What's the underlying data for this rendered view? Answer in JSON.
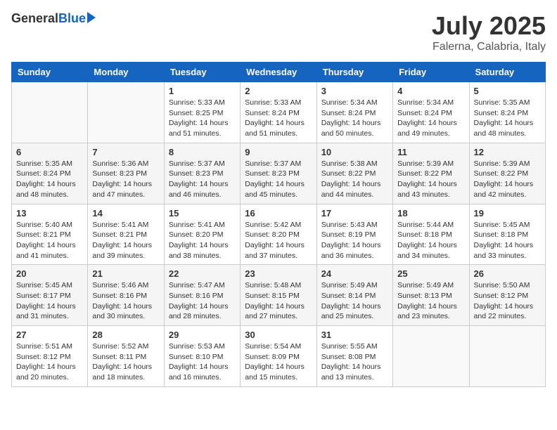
{
  "logo": {
    "general": "General",
    "blue": "Blue"
  },
  "title": "July 2025",
  "location": "Falerna, Calabria, Italy",
  "days_of_week": [
    "Sunday",
    "Monday",
    "Tuesday",
    "Wednesday",
    "Thursday",
    "Friday",
    "Saturday"
  ],
  "weeks": [
    [
      {
        "day": "",
        "info": ""
      },
      {
        "day": "",
        "info": ""
      },
      {
        "day": "1",
        "sunrise": "Sunrise: 5:33 AM",
        "sunset": "Sunset: 8:25 PM",
        "daylight": "Daylight: 14 hours and 51 minutes."
      },
      {
        "day": "2",
        "sunrise": "Sunrise: 5:33 AM",
        "sunset": "Sunset: 8:24 PM",
        "daylight": "Daylight: 14 hours and 51 minutes."
      },
      {
        "day": "3",
        "sunrise": "Sunrise: 5:34 AM",
        "sunset": "Sunset: 8:24 PM",
        "daylight": "Daylight: 14 hours and 50 minutes."
      },
      {
        "day": "4",
        "sunrise": "Sunrise: 5:34 AM",
        "sunset": "Sunset: 8:24 PM",
        "daylight": "Daylight: 14 hours and 49 minutes."
      },
      {
        "day": "5",
        "sunrise": "Sunrise: 5:35 AM",
        "sunset": "Sunset: 8:24 PM",
        "daylight": "Daylight: 14 hours and 48 minutes."
      }
    ],
    [
      {
        "day": "6",
        "sunrise": "Sunrise: 5:35 AM",
        "sunset": "Sunset: 8:24 PM",
        "daylight": "Daylight: 14 hours and 48 minutes."
      },
      {
        "day": "7",
        "sunrise": "Sunrise: 5:36 AM",
        "sunset": "Sunset: 8:23 PM",
        "daylight": "Daylight: 14 hours and 47 minutes."
      },
      {
        "day": "8",
        "sunrise": "Sunrise: 5:37 AM",
        "sunset": "Sunset: 8:23 PM",
        "daylight": "Daylight: 14 hours and 46 minutes."
      },
      {
        "day": "9",
        "sunrise": "Sunrise: 5:37 AM",
        "sunset": "Sunset: 8:23 PM",
        "daylight": "Daylight: 14 hours and 45 minutes."
      },
      {
        "day": "10",
        "sunrise": "Sunrise: 5:38 AM",
        "sunset": "Sunset: 8:22 PM",
        "daylight": "Daylight: 14 hours and 44 minutes."
      },
      {
        "day": "11",
        "sunrise": "Sunrise: 5:39 AM",
        "sunset": "Sunset: 8:22 PM",
        "daylight": "Daylight: 14 hours and 43 minutes."
      },
      {
        "day": "12",
        "sunrise": "Sunrise: 5:39 AM",
        "sunset": "Sunset: 8:22 PM",
        "daylight": "Daylight: 14 hours and 42 minutes."
      }
    ],
    [
      {
        "day": "13",
        "sunrise": "Sunrise: 5:40 AM",
        "sunset": "Sunset: 8:21 PM",
        "daylight": "Daylight: 14 hours and 41 minutes."
      },
      {
        "day": "14",
        "sunrise": "Sunrise: 5:41 AM",
        "sunset": "Sunset: 8:21 PM",
        "daylight": "Daylight: 14 hours and 39 minutes."
      },
      {
        "day": "15",
        "sunrise": "Sunrise: 5:41 AM",
        "sunset": "Sunset: 8:20 PM",
        "daylight": "Daylight: 14 hours and 38 minutes."
      },
      {
        "day": "16",
        "sunrise": "Sunrise: 5:42 AM",
        "sunset": "Sunset: 8:20 PM",
        "daylight": "Daylight: 14 hours and 37 minutes."
      },
      {
        "day": "17",
        "sunrise": "Sunrise: 5:43 AM",
        "sunset": "Sunset: 8:19 PM",
        "daylight": "Daylight: 14 hours and 36 minutes."
      },
      {
        "day": "18",
        "sunrise": "Sunrise: 5:44 AM",
        "sunset": "Sunset: 8:18 PM",
        "daylight": "Daylight: 14 hours and 34 minutes."
      },
      {
        "day": "19",
        "sunrise": "Sunrise: 5:45 AM",
        "sunset": "Sunset: 8:18 PM",
        "daylight": "Daylight: 14 hours and 33 minutes."
      }
    ],
    [
      {
        "day": "20",
        "sunrise": "Sunrise: 5:45 AM",
        "sunset": "Sunset: 8:17 PM",
        "daylight": "Daylight: 14 hours and 31 minutes."
      },
      {
        "day": "21",
        "sunrise": "Sunrise: 5:46 AM",
        "sunset": "Sunset: 8:16 PM",
        "daylight": "Daylight: 14 hours and 30 minutes."
      },
      {
        "day": "22",
        "sunrise": "Sunrise: 5:47 AM",
        "sunset": "Sunset: 8:16 PM",
        "daylight": "Daylight: 14 hours and 28 minutes."
      },
      {
        "day": "23",
        "sunrise": "Sunrise: 5:48 AM",
        "sunset": "Sunset: 8:15 PM",
        "daylight": "Daylight: 14 hours and 27 minutes."
      },
      {
        "day": "24",
        "sunrise": "Sunrise: 5:49 AM",
        "sunset": "Sunset: 8:14 PM",
        "daylight": "Daylight: 14 hours and 25 minutes."
      },
      {
        "day": "25",
        "sunrise": "Sunrise: 5:49 AM",
        "sunset": "Sunset: 8:13 PM",
        "daylight": "Daylight: 14 hours and 23 minutes."
      },
      {
        "day": "26",
        "sunrise": "Sunrise: 5:50 AM",
        "sunset": "Sunset: 8:12 PM",
        "daylight": "Daylight: 14 hours and 22 minutes."
      }
    ],
    [
      {
        "day": "27",
        "sunrise": "Sunrise: 5:51 AM",
        "sunset": "Sunset: 8:12 PM",
        "daylight": "Daylight: 14 hours and 20 minutes."
      },
      {
        "day": "28",
        "sunrise": "Sunrise: 5:52 AM",
        "sunset": "Sunset: 8:11 PM",
        "daylight": "Daylight: 14 hours and 18 minutes."
      },
      {
        "day": "29",
        "sunrise": "Sunrise: 5:53 AM",
        "sunset": "Sunset: 8:10 PM",
        "daylight": "Daylight: 14 hours and 16 minutes."
      },
      {
        "day": "30",
        "sunrise": "Sunrise: 5:54 AM",
        "sunset": "Sunset: 8:09 PM",
        "daylight": "Daylight: 14 hours and 15 minutes."
      },
      {
        "day": "31",
        "sunrise": "Sunrise: 5:55 AM",
        "sunset": "Sunset: 8:08 PM",
        "daylight": "Daylight: 14 hours and 13 minutes."
      },
      {
        "day": "",
        "info": ""
      },
      {
        "day": "",
        "info": ""
      }
    ]
  ]
}
